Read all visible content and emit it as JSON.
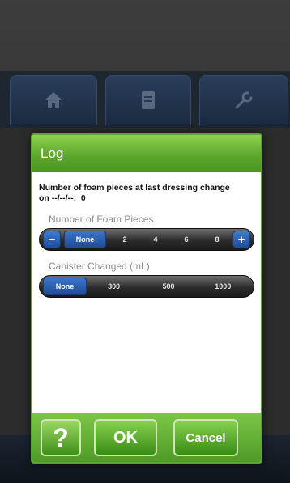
{
  "background": {
    "tabs": [
      {
        "icon": "home-icon"
      },
      {
        "icon": "document-icon"
      },
      {
        "icon": "tools-icon"
      }
    ]
  },
  "dialog": {
    "title": "Log",
    "last_change": {
      "line1": "Number of foam pieces at last dressing change",
      "on_label": "on",
      "date": "--/--/--:",
      "count": "0"
    },
    "foam": {
      "label": "Number of Foam Pieces",
      "minus": "−",
      "plus": "+",
      "options": [
        "None",
        "2",
        "4",
        "6",
        "8"
      ],
      "selected": "None"
    },
    "canister": {
      "label": "Canister Changed (mL)",
      "options": [
        "None",
        "300",
        "500",
        "1000"
      ],
      "selected": "None"
    },
    "buttons": {
      "help": "?",
      "ok": "OK",
      "cancel": "Cancel"
    }
  },
  "colors": {
    "header_green": "#5aa52a",
    "selected_blue": "#204c95"
  }
}
